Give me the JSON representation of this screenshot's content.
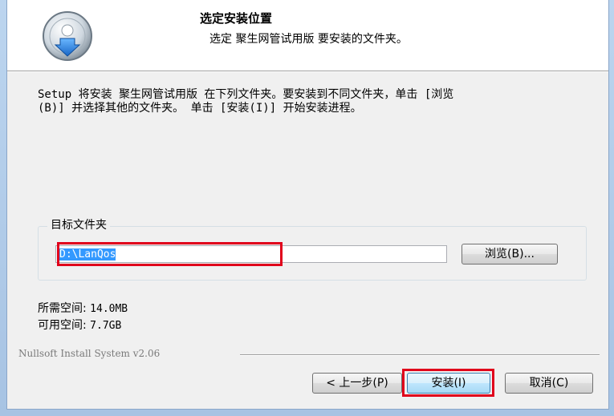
{
  "header": {
    "title": "选定安装位置",
    "subtitle": "选定 聚生网管试用版 要安装的文件夹。"
  },
  "body": {
    "intro": "Setup 将安装 聚生网管试用版 在下列文件夹。要安装到不同文件夹，单击 [浏览\n(B)] 并选择其他的文件夹。 单击 [安装(I)] 开始安装进程。",
    "group_label": "目标文件夹",
    "path_value": "D:\\LanQos",
    "browse_label": "浏览(B)...",
    "required_label": "所需空间: ",
    "required_value": "14.0MB",
    "available_label": "可用空间: ",
    "available_value": "7.7GB"
  },
  "footer": {
    "branding": "Nullsoft Install System v2.06",
    "back_label": "< 上一步(P)",
    "install_label": "安装(I)",
    "cancel_label": "取消(C)"
  },
  "icons": {
    "logo": "installer-disc-icon"
  },
  "colors": {
    "highlight_box": "#e0001b",
    "selection": "#3399ff"
  }
}
